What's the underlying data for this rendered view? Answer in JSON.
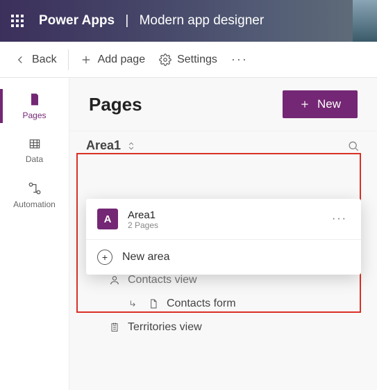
{
  "header": {
    "brand": "Power Apps",
    "subtitle": "Modern app designer"
  },
  "commandbar": {
    "back": "Back",
    "add_page": "Add page",
    "settings": "Settings"
  },
  "rail": {
    "pages": "Pages",
    "data": "Data",
    "automation": "Automation"
  },
  "main": {
    "title": "Pages",
    "new_button": "New"
  },
  "area_selector": {
    "current": "Area1"
  },
  "dropdown": {
    "items": [
      {
        "initial": "A",
        "name": "Area1",
        "subtitle": "2 Pages"
      }
    ],
    "new_area": "New area"
  },
  "tree": {
    "contacts_view": "Contacts view",
    "contacts_form": "Contacts form",
    "territories_view": "Territories view"
  },
  "colors": {
    "accent": "#742774"
  }
}
